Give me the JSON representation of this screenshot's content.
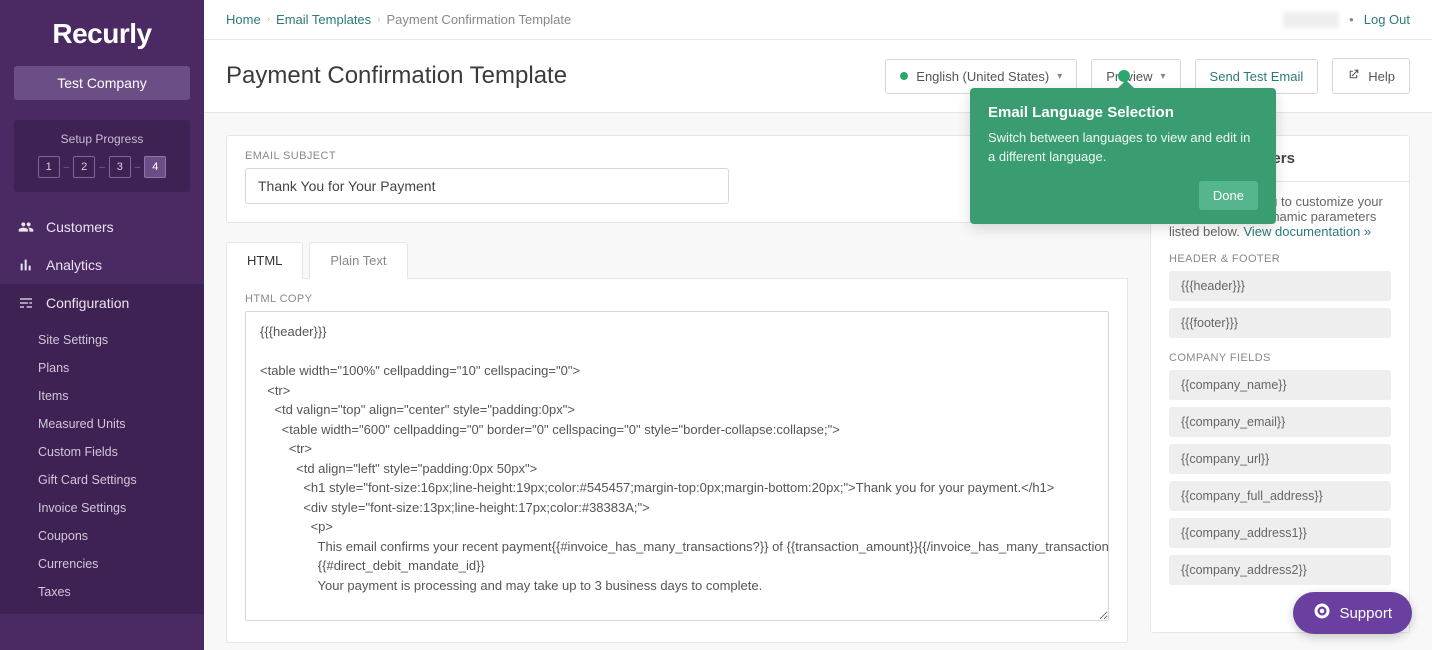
{
  "brand": "Recurly",
  "company_button": "Test Company",
  "setup": {
    "title": "Setup Progress",
    "steps": [
      "1",
      "2",
      "3",
      "4"
    ],
    "active_index": 3
  },
  "nav": {
    "customers": "Customers",
    "analytics": "Analytics",
    "configuration": "Configuration",
    "subitems": [
      "Site Settings",
      "Plans",
      "Items",
      "Measured Units",
      "Custom Fields",
      "Gift Card Settings",
      "Invoice Settings",
      "Coupons",
      "Currencies",
      "Taxes"
    ]
  },
  "breadcrumb": {
    "home": "Home",
    "templates": "Email Templates",
    "current": "Payment Confirmation Template"
  },
  "topright": {
    "logout": "Log Out"
  },
  "titlebar": {
    "title": "Payment Confirmation Template",
    "language": "English (United States)",
    "preview": "Preview",
    "send_test": "Send Test Email",
    "help": "Help"
  },
  "callout": {
    "title": "Email Language Selection",
    "body": "Switch between languages to view and edit in a different language.",
    "done": "Done"
  },
  "subject": {
    "label": "EMAIL SUBJECT",
    "value": "Thank You for Your Payment"
  },
  "tabs": {
    "html": "HTML",
    "plain": "Plain Text"
  },
  "editor": {
    "label": "HTML COPY",
    "body": "{{{header}}}\n\n<table width=\"100%\" cellpadding=\"10\" cellspacing=\"0\">\n  <tr>\n    <td valign=\"top\" align=\"center\" style=\"padding:0px\">\n      <table width=\"600\" cellpadding=\"0\" border=\"0\" cellspacing=\"0\" style=\"border-collapse:collapse;\">\n        <tr>\n          <td align=\"left\" style=\"padding:0px 50px\">\n            <h1 style=\"font-size:16px;line-height:19px;color:#545457;margin-top:0px;margin-bottom:20px;\">Thank you for your payment.</h1>\n            <div style=\"font-size:13px;line-height:17px;color:#38383A;\">\n              <p>\n                This email confirms your recent payment{{#invoice_has_many_transactions?}} of {{transaction_amount}}{{/invoice_has_many_transactions?}}.\n                {{#direct_debit_mandate_id}}\n                Your payment is processing and may take up to 3 business days to complete."
  },
  "params": {
    "title": "Email Parameters",
    "intro": "Recurly allows you to customize your emails with the dynamic parameters listed below. ",
    "doc_link": "View documentation »",
    "groups": [
      {
        "label": "HEADER & FOOTER",
        "items": [
          "{{{header}}}",
          "{{{footer}}}"
        ]
      },
      {
        "label": "COMPANY FIELDS",
        "items": [
          "{{company_name}}",
          "{{company_email}}",
          "{{company_url}}",
          "{{company_full_address}}",
          "{{company_address1}}",
          "{{company_address2}}"
        ]
      }
    ]
  },
  "support": "Support"
}
